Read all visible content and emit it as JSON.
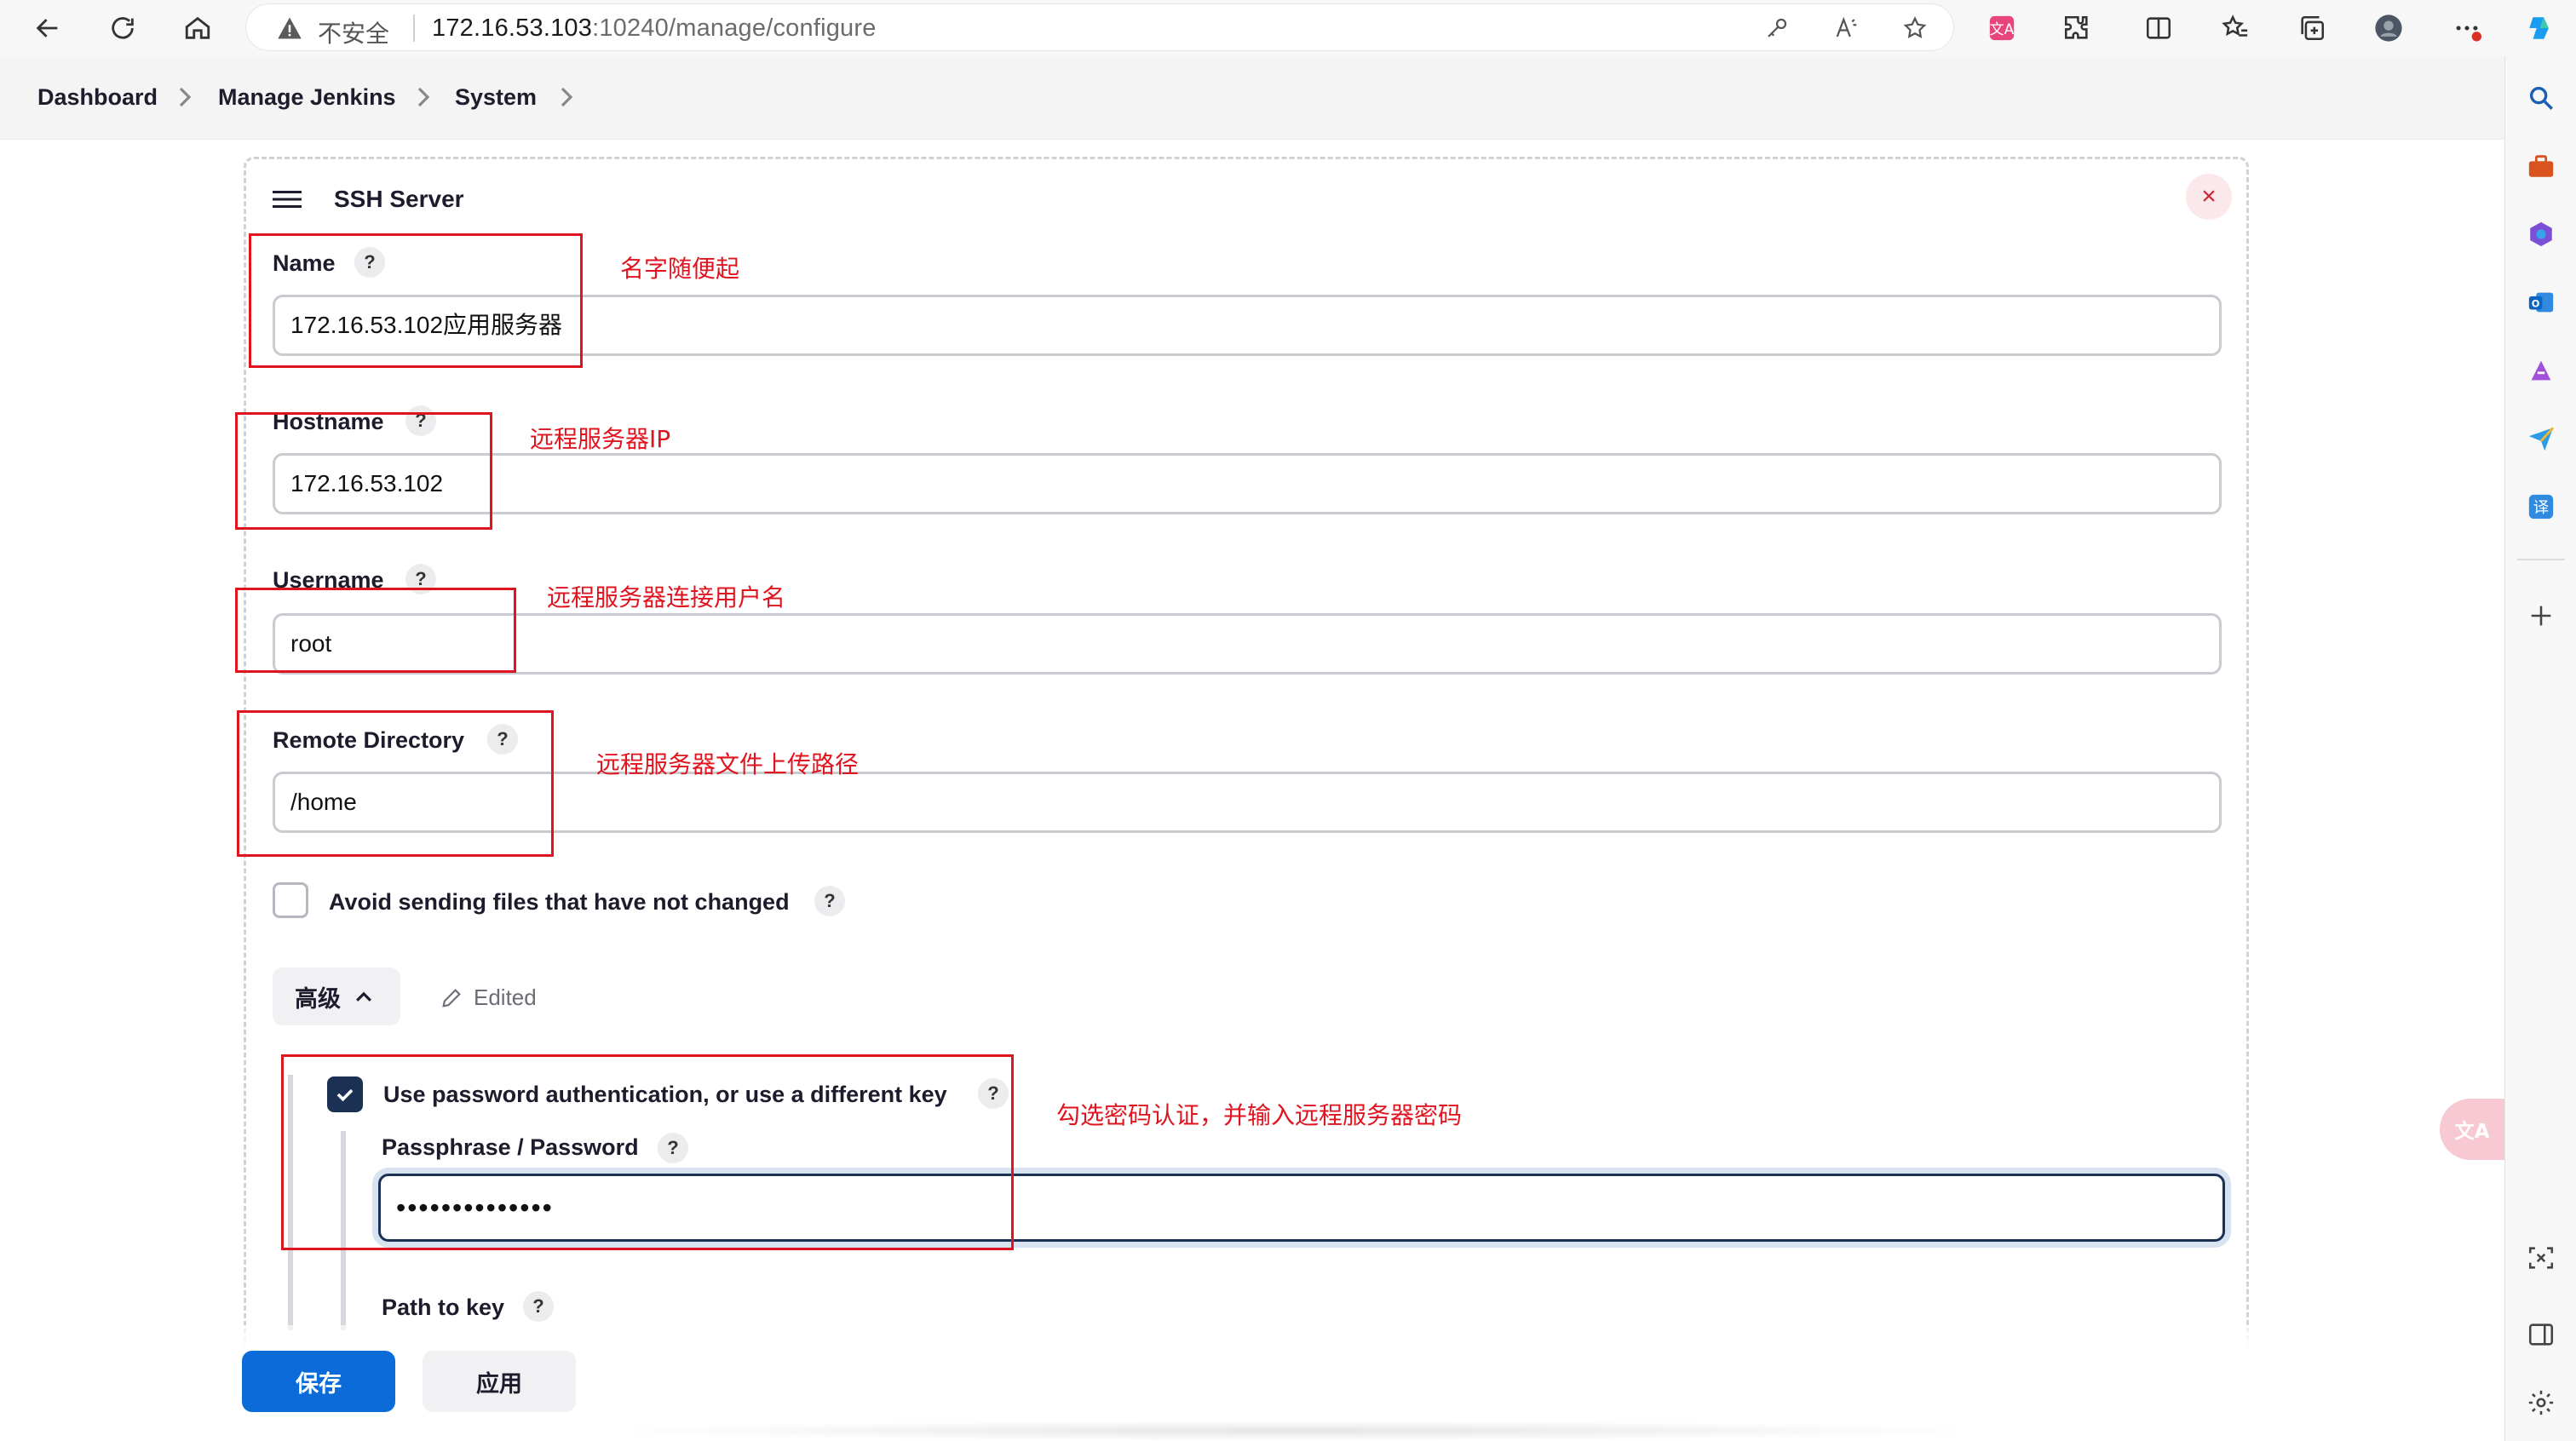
{
  "browser": {
    "address_insecure": "不安全",
    "url_host": "172.16.53.103",
    "url_rest": ":10240/manage/configure"
  },
  "breadcrumb": [
    "Dashboard",
    "Manage Jenkins",
    "System"
  ],
  "section": {
    "title": "SSH Server",
    "close_label": "×"
  },
  "fields": {
    "name": {
      "label": "Name",
      "value": "172.16.53.102应用服务器"
    },
    "hostname": {
      "label": "Hostname",
      "value": "172.16.53.102"
    },
    "username": {
      "label": "Username",
      "value": "root"
    },
    "remote_directory": {
      "label": "Remote Directory",
      "value": "/home"
    }
  },
  "help_glyph": "?",
  "avoid_sending": {
    "label": "Avoid sending files that have not changed",
    "checked": false
  },
  "advanced": {
    "label": "高级",
    "edited": "Edited"
  },
  "password_auth": {
    "label": "Use password authentication, or use a different key",
    "checked": true,
    "passphrase_label": "Passphrase / Password",
    "passphrase_value": "••••••••••••••",
    "path_to_key_label": "Path to key"
  },
  "annotations": {
    "name": "名字随便起",
    "hostname": "远程服务器IP",
    "username": "远程服务器连接用户名",
    "remote_directory": "远程服务器文件上传路径",
    "password": "勾选密码认证，并输入远程服务器密码"
  },
  "buttons": {
    "save": "保存",
    "apply": "应用"
  },
  "colors": {
    "primary": "#0b6cd9",
    "annotation": "#e0141e",
    "checkbox_checked": "#1b3154",
    "close": "#d0203a"
  }
}
